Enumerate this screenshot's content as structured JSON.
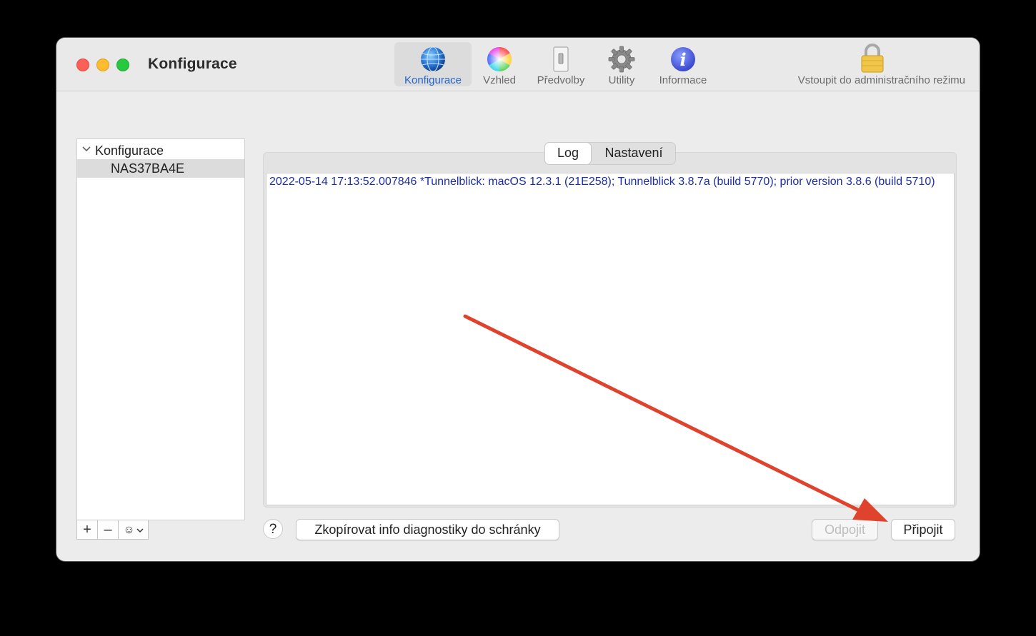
{
  "window": {
    "title": "Konfigurace"
  },
  "toolbar": {
    "items": [
      {
        "label": "Konfigurace",
        "icon": "globe-icon"
      },
      {
        "label": "Vzhled",
        "icon": "color-wheel-icon"
      },
      {
        "label": "Předvolby",
        "icon": "switch-icon"
      },
      {
        "label": "Utility",
        "icon": "gear-icon"
      },
      {
        "label": "Informace",
        "icon": "info-icon"
      }
    ],
    "admin_label": "Vstoupit do administračního režimu"
  },
  "sidebar": {
    "group_label": "Konfigurace",
    "items": [
      {
        "label": "NAS37BA4E"
      }
    ],
    "tools": {
      "add": "+",
      "remove": "–",
      "actions": "☺"
    }
  },
  "tabs": [
    {
      "label": "Log"
    },
    {
      "label": "Nastavení"
    }
  ],
  "log": {
    "text": "2022-05-14 17:13:52.007846 *Tunnelblick: macOS 12.3.1 (21E258); Tunnelblick 3.8.7a (build 5770); prior version 3.8.6 (build 5710)"
  },
  "buttons": {
    "help": "?",
    "copy_diagnostics": "Zkopírovat info diagnostiky do schránky",
    "disconnect": "Odpojit",
    "connect": "Připojit"
  },
  "colors": {
    "accent": "#2465c7",
    "log_text": "#1b2ea8",
    "annotation_arrow": "#e0432d"
  }
}
